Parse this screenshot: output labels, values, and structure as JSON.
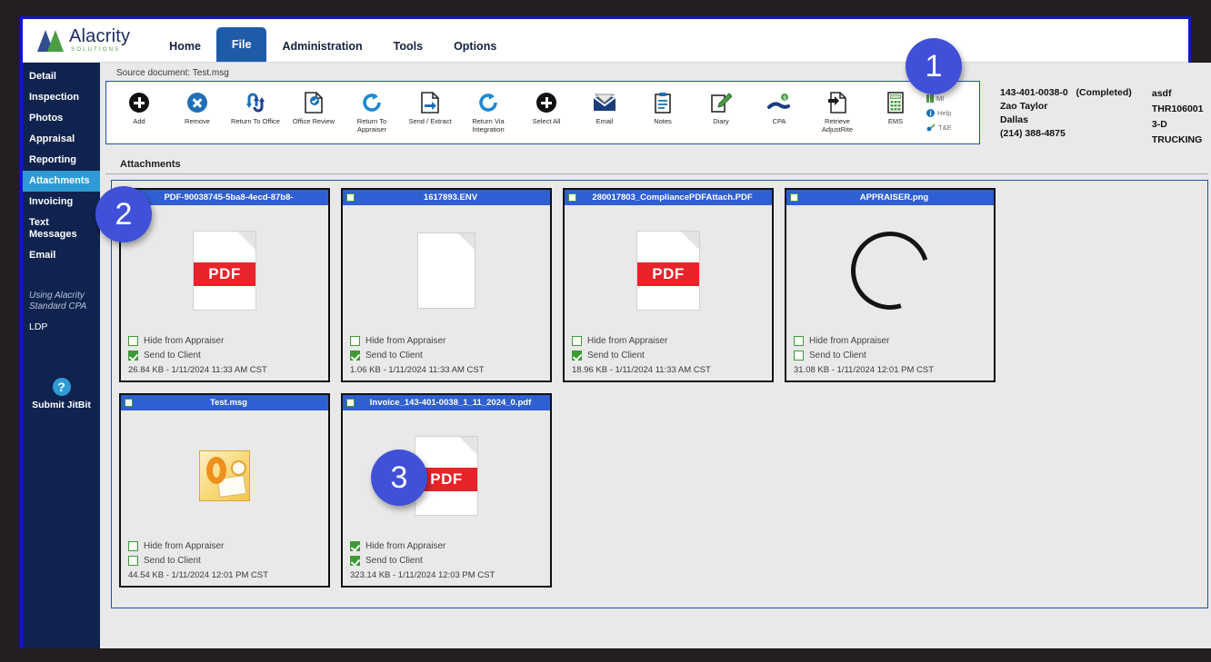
{
  "top_nav": {
    "brand_name": "Alacrity",
    "brand_sub": "SOLUTIONS",
    "items": [
      {
        "label": "Home",
        "active": false
      },
      {
        "label": "File",
        "active": true
      },
      {
        "label": "Administration",
        "active": false
      },
      {
        "label": "Tools",
        "active": false
      },
      {
        "label": "Options",
        "active": false
      }
    ]
  },
  "sidebar": {
    "items": [
      {
        "label": "Detail",
        "active": false
      },
      {
        "label": "Inspection",
        "active": false
      },
      {
        "label": "Photos",
        "active": false
      },
      {
        "label": "Appraisal",
        "active": false
      },
      {
        "label": "Reporting",
        "active": false
      },
      {
        "label": "Attachments",
        "active": true
      },
      {
        "label": "Invoicing",
        "active": false
      },
      {
        "label": "Text Messages",
        "active": false
      },
      {
        "label": "Email",
        "active": false
      }
    ],
    "note": "Using Alacrity Standard CPA",
    "ldp_label": "LDP",
    "help_icon": "?",
    "help_label": "Submit JitBit"
  },
  "source_document": "Source document: Test.msg",
  "ribbon": {
    "buttons": [
      {
        "label": "Add",
        "icon": "plus-circle-black-icon"
      },
      {
        "label": "Remove",
        "icon": "x-circle-blue-icon"
      },
      {
        "label": "Return To Office",
        "icon": "two-arrows-icon"
      },
      {
        "label": "Office Review",
        "icon": "document-check-icon"
      },
      {
        "label": "Return To Appraiser",
        "icon": "refresh-circle-icon"
      },
      {
        "label": "Send / Extract",
        "icon": "document-export-icon"
      },
      {
        "label": "Return Via Integration",
        "icon": "refresh-circle-icon"
      },
      {
        "label": "Select All",
        "icon": "plus-circle-black-icon"
      },
      {
        "label": "Email",
        "icon": "envelope-icon"
      },
      {
        "label": "Notes",
        "icon": "clipboard-icon"
      },
      {
        "label": "Diary",
        "icon": "pencil-note-icon"
      },
      {
        "label": "CPA",
        "icon": "hand-money-icon"
      },
      {
        "label": "Retrieve AdjustRite",
        "icon": "document-import-icon"
      },
      {
        "label": "EMS",
        "icon": "calculator-icon"
      }
    ],
    "links": [
      {
        "label": "MI",
        "icon": "book-icon"
      },
      {
        "label": "Help",
        "icon": "info-icon"
      },
      {
        "label": "T&E",
        "icon": "link-icon"
      }
    ]
  },
  "info_panel": {
    "claim_number": "143-401-0038-0",
    "status": "(Completed)",
    "contact_name": "Zao Taylor",
    "city": "Dallas",
    "phone": "(214) 388-4875",
    "ref_1": "asdf",
    "ref_2": "THR106001",
    "ref_3": "3-D TRUCKING"
  },
  "attachments": {
    "section_title": "Attachments",
    "option_hide_label": "Hide from Appraiser",
    "option_send_label": "Send to Client",
    "cards": [
      {
        "name": "PDF-90038745-5ba8-4ecd-87b8-",
        "thumb": "pdf",
        "selected": false,
        "hide_from_appraiser": false,
        "send_to_client": true,
        "meta": "26.84 KB - 1/11/2024 11:33 AM CST"
      },
      {
        "name": "1617893.ENV",
        "thumb": "blank",
        "selected": false,
        "hide_from_appraiser": false,
        "send_to_client": true,
        "meta": "1.06 KB - 1/11/2024 11:33 AM CST"
      },
      {
        "name": "280017803_CompliancePDFAttach.PDF",
        "thumb": "pdf",
        "selected": false,
        "hide_from_appraiser": false,
        "send_to_client": true,
        "meta": "18.96 KB - 1/11/2024 11:33 AM CST"
      },
      {
        "name": "APPRAISER.png",
        "thumb": "ring",
        "selected": false,
        "hide_from_appraiser": false,
        "send_to_client": false,
        "meta": "31.08 KB - 1/11/2024 12:01 PM CST"
      },
      {
        "name": "Test.msg",
        "thumb": "msg",
        "selected": false,
        "hide_from_appraiser": false,
        "send_to_client": false,
        "meta": "44.54 KB - 1/11/2024 12:01 PM CST"
      },
      {
        "name": "Invoice_143-401-0038_1_11_2024_0.pdf",
        "thumb": "pdf",
        "selected": false,
        "hide_from_appraiser": true,
        "send_to_client": true,
        "meta": "323.14 KB - 1/11/2024 12:03 PM CST"
      }
    ]
  },
  "badges": [
    {
      "label": "1"
    },
    {
      "label": "2"
    },
    {
      "label": "3"
    }
  ],
  "colors": {
    "accent_blue": "#1f5ca8",
    "sidebar_navy": "#10234f",
    "badge_blue": "#4050d8",
    "title_blue": "#2f5fd0",
    "check_green": "#3d9b35",
    "pdf_red": "#e8232a"
  }
}
